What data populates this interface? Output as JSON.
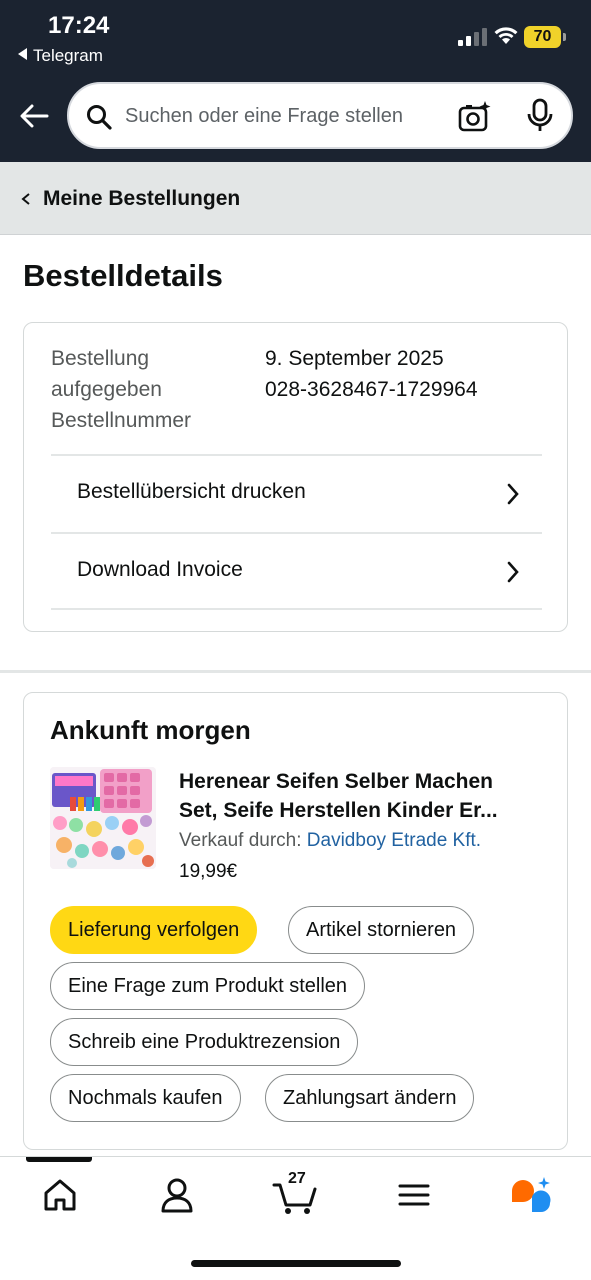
{
  "status_bar": {
    "time": "17:24",
    "back_app": "Telegram",
    "battery": "70"
  },
  "header": {
    "search_placeholder": "Suchen oder eine Frage stellen"
  },
  "breadcrumb": {
    "label": "Meine Bestellungen"
  },
  "page_title": "Bestelldetails",
  "order_info": {
    "labels": [
      "Bestellung",
      "aufgegeben",
      "Bestellnummer"
    ],
    "date": "9. September 2025",
    "number": "028-3628467-1729964",
    "links": [
      {
        "label": "Bestellübersicht drucken"
      },
      {
        "label": "Download Invoice"
      }
    ]
  },
  "shipment": {
    "arrival": "Ankunft morgen",
    "product_title_line1": "Herenear Seifen Selber Machen",
    "product_title_line2": "Set, Seife Herstellen Kinder Er...",
    "seller_prefix": "Verkauf durch: ",
    "seller_name": "Davidboy Etrade Kft.",
    "price": "19,99€",
    "actions": [
      "Lieferung verfolgen",
      "Artikel stornieren",
      "Eine Frage zum Produkt stellen",
      "Schreib eine Produktrezension",
      "Nochmals kaufen",
      "Zahlungsart ändern"
    ]
  },
  "bottom_nav": {
    "cart_count": "27",
    "items": [
      "home-icon",
      "account-icon",
      "cart-icon",
      "menu-icon",
      "rufus-icon"
    ],
    "accent_color": "#ff6a00"
  }
}
